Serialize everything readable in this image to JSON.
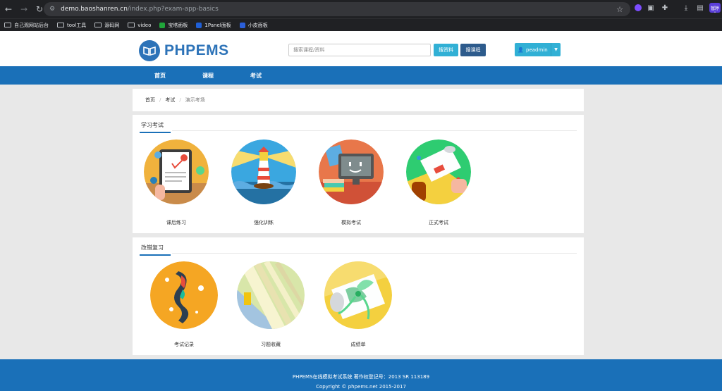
{
  "browser": {
    "url_host": "demo.baoshanren.cn",
    "url_path": "/index.php?exam-app-basics",
    "bookmarks": [
      "自己观网站后台",
      "tool工具",
      "源码网",
      "video",
      "宝塔面板",
      "1Panel面板",
      "小皮面板"
    ],
    "profile_badge": "暂停"
  },
  "header": {
    "logo_text": "PHPEMS",
    "search_placeholder": "搜索课程/资料",
    "search_materials_label": "搜资料",
    "search_courses_label": "搜课程",
    "user_name": "peadmin"
  },
  "nav": {
    "items": [
      "首页",
      "课程",
      "考试"
    ]
  },
  "breadcrumb": {
    "items": [
      "首页",
      "考试",
      "演示考场"
    ]
  },
  "section_study": {
    "title": "学习考试",
    "tiles": [
      "课后练习",
      "强化训练",
      "模拟考试",
      "正式考试"
    ]
  },
  "section_review": {
    "title": "改错复习",
    "tiles": [
      "考试记录",
      "习题收藏",
      "成绩单"
    ]
  },
  "footer": {
    "line1": "PHPEMS在线模拟考试系统 著作权登记号：2013 SR 113189",
    "line2": "Copyright © phpems.net 2015-2017"
  },
  "colors": {
    "brand": "#1a70b8",
    "accent": "#31b0d5"
  }
}
